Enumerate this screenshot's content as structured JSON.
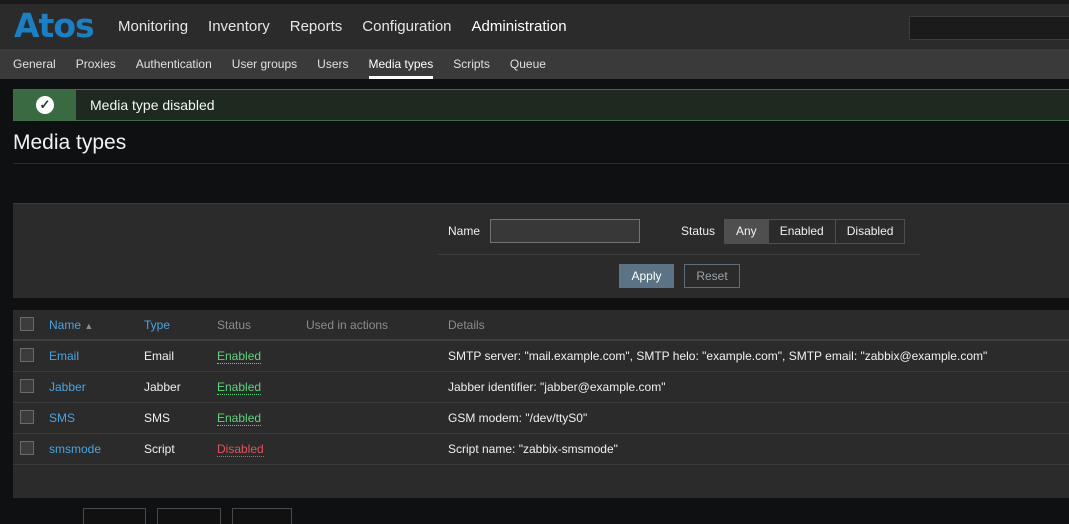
{
  "header": {
    "logo_text": "Atos",
    "main_nav": [
      "Monitoring",
      "Inventory",
      "Reports",
      "Configuration",
      "Administration"
    ],
    "active_main": "Administration",
    "sub_nav": [
      "General",
      "Proxies",
      "Authentication",
      "User groups",
      "Users",
      "Media types",
      "Scripts",
      "Queue"
    ],
    "active_sub": "Media types"
  },
  "message": {
    "text": "Media type disabled",
    "icon": "check-circle-icon"
  },
  "page": {
    "title": "Media types"
  },
  "filter": {
    "name_label": "Name",
    "name_value": "",
    "status_label": "Status",
    "status_options": [
      "Any",
      "Enabled",
      "Disabled"
    ],
    "status_selected": "Any",
    "apply_label": "Apply",
    "reset_label": "Reset"
  },
  "table": {
    "columns": {
      "name": "Name",
      "sort_indicator": "▲",
      "type": "Type",
      "status": "Status",
      "used": "Used in actions",
      "details": "Details"
    },
    "rows": [
      {
        "name": "Email",
        "type": "Email",
        "status": "Enabled",
        "used": "",
        "details": "SMTP server: \"mail.example.com\", SMTP helo: \"example.com\", SMTP email: \"zabbix@example.com\""
      },
      {
        "name": "Jabber",
        "type": "Jabber",
        "status": "Enabled",
        "used": "",
        "details": "Jabber identifier: \"jabber@example.com\""
      },
      {
        "name": "SMS",
        "type": "SMS",
        "status": "Enabled",
        "used": "",
        "details": "GSM modem: \"/dev/ttyS0\""
      },
      {
        "name": "smsmode",
        "type": "Script",
        "status": "Disabled",
        "used": "",
        "details": "Script name: \"zabbix-smsmode\""
      }
    ]
  },
  "colors": {
    "link": "#4aa3e0",
    "enabled": "#5fd37e",
    "disabled": "#e0535b",
    "logo": "#1b7fc4",
    "success_bg": "#3a6a42"
  }
}
